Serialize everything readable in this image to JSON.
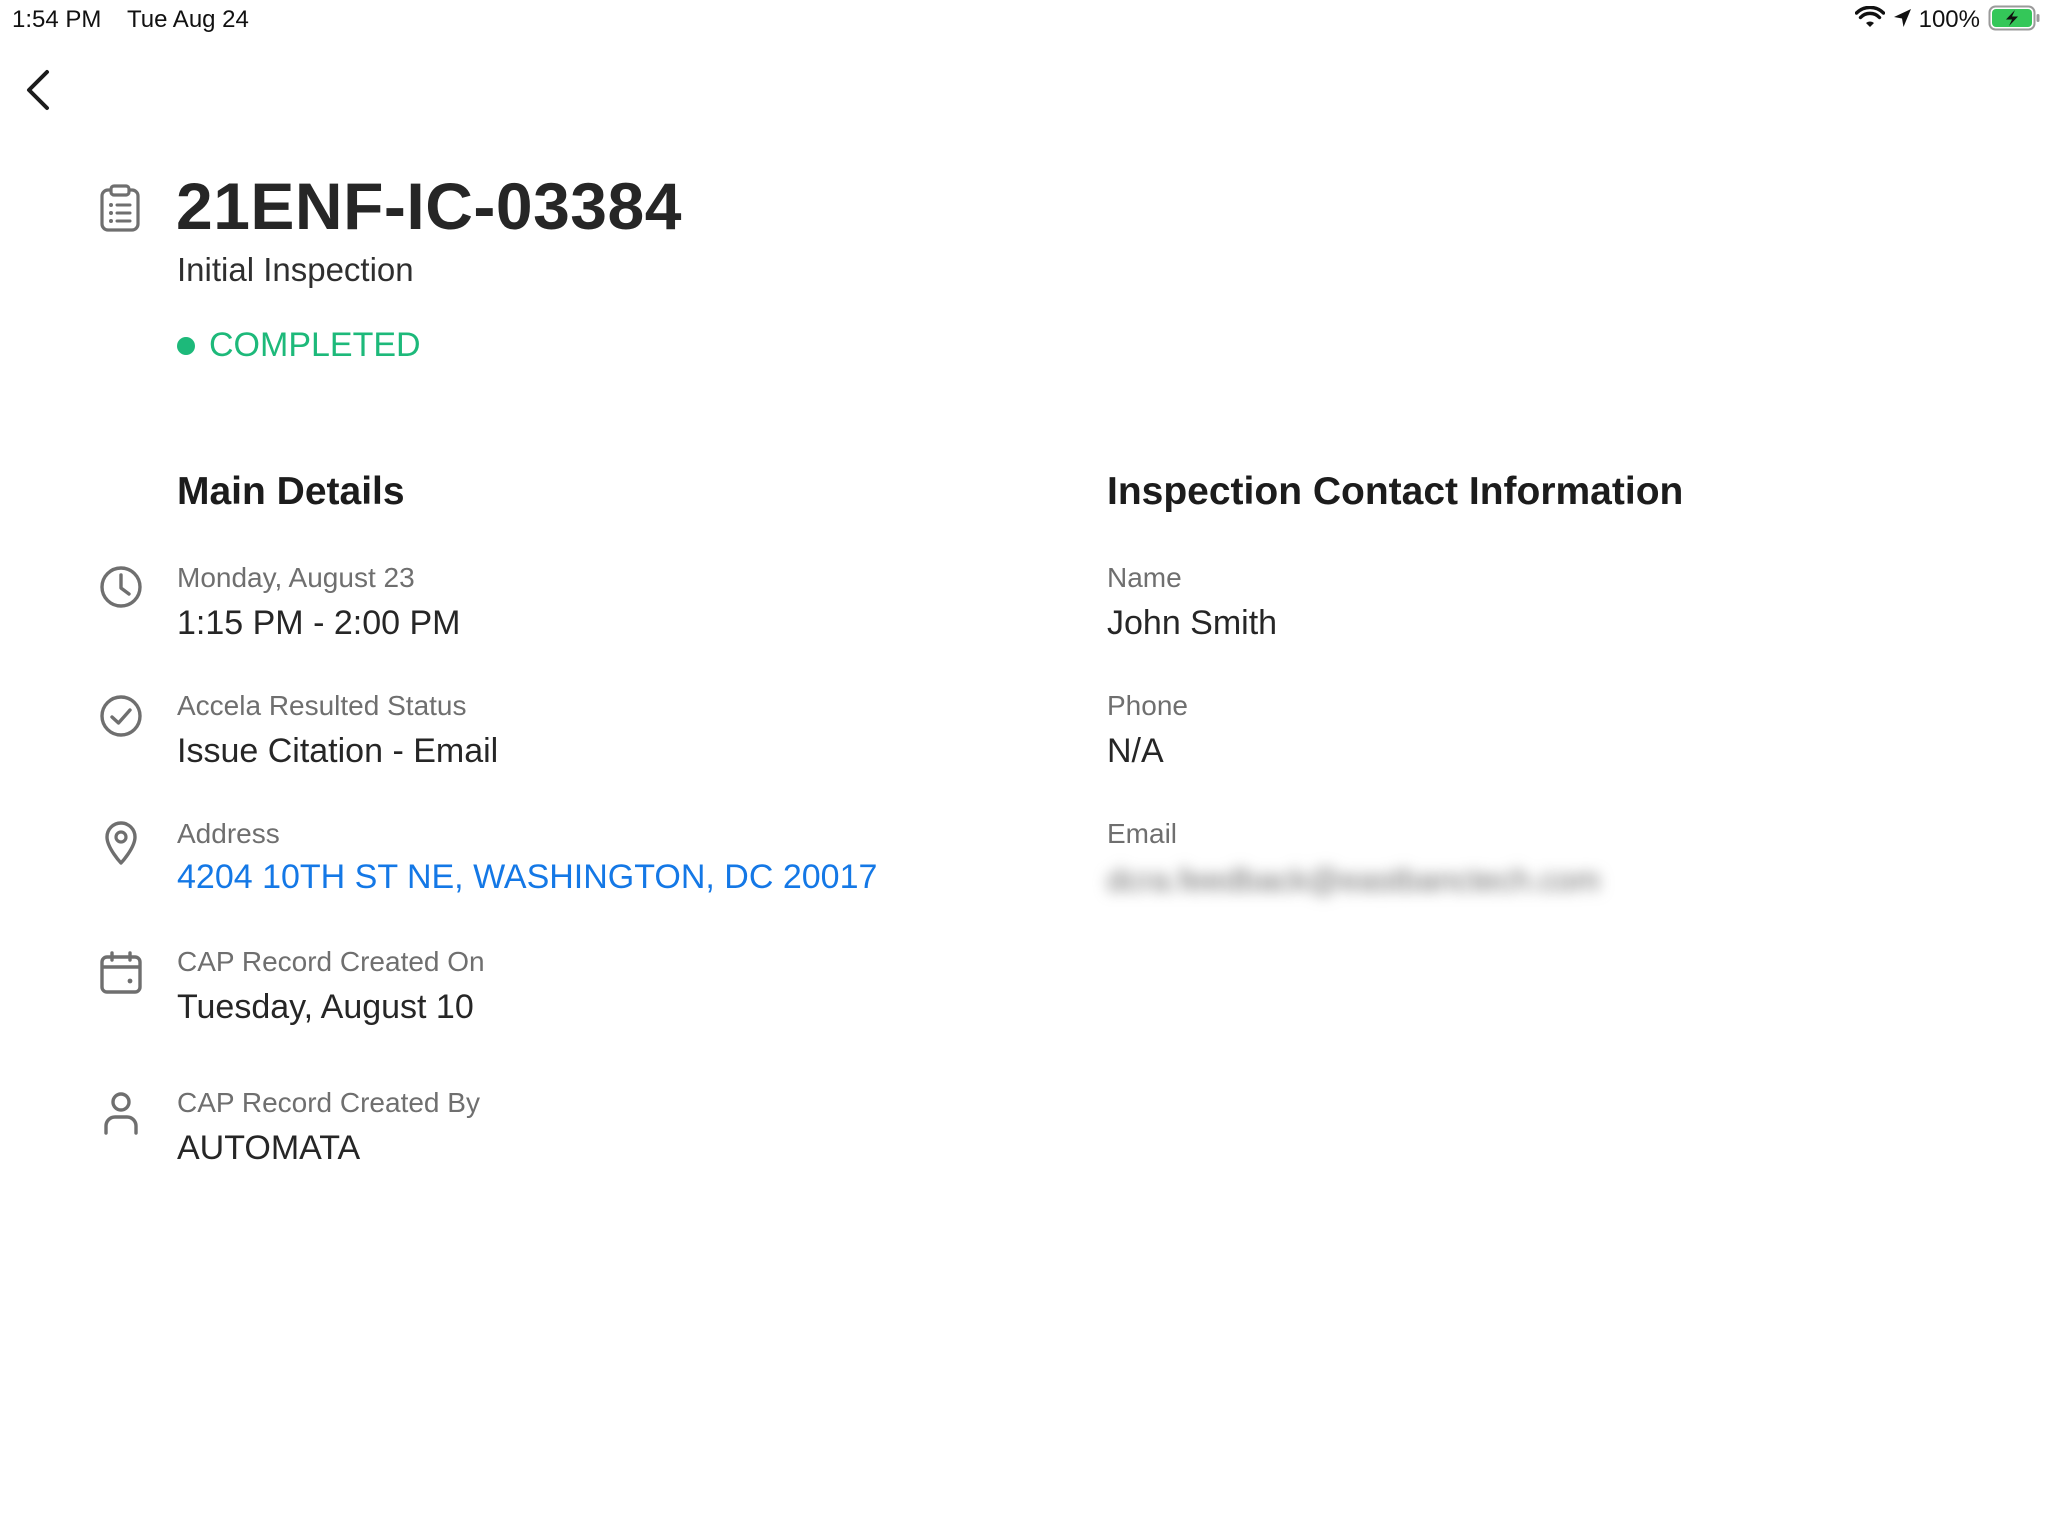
{
  "status_bar": {
    "time": "1:54 PM",
    "date": "Tue Aug 24",
    "battery": "100%",
    "icons": [
      "wifi-icon",
      "location-arrow-icon",
      "battery-charging-icon"
    ]
  },
  "nav": {
    "back_icon": "chevron-left-icon"
  },
  "header": {
    "icon": "clipboard-list-icon",
    "title": "21ENF-IC-03384",
    "subtitle": "Initial Inspection",
    "status": "COMPLETED",
    "status_color": "#1db97a"
  },
  "main_details": {
    "title": "Main Details",
    "items": [
      {
        "icon": "clock-icon",
        "label": "Monday, August 23",
        "value": "1:15 PM - 2:00 PM"
      },
      {
        "icon": "check-circle-icon",
        "label": "Accela Resulted Status",
        "value": "Issue Citation - Email"
      },
      {
        "icon": "map-pin-icon",
        "label": "Address",
        "value": "4204 10TH ST NE, WASHINGTON, DC 20017"
      },
      {
        "icon": "calendar-icon",
        "label": "CAP Record Created On",
        "value": "Tuesday, August 10"
      },
      {
        "icon": "user-icon",
        "label": "CAP Record Created By",
        "value": "AUTOMATA"
      }
    ]
  },
  "contact": {
    "title": "Inspection Contact Information",
    "items": [
      {
        "label": "Name",
        "value": "John Smith"
      },
      {
        "label": "Phone",
        "value": "N/A"
      },
      {
        "label": "Email",
        "value": "dcra.feedback@eastbanctech.com"
      }
    ]
  },
  "colors": {
    "link": "#1478e6",
    "icon_gray": "#6f6f6f"
  }
}
